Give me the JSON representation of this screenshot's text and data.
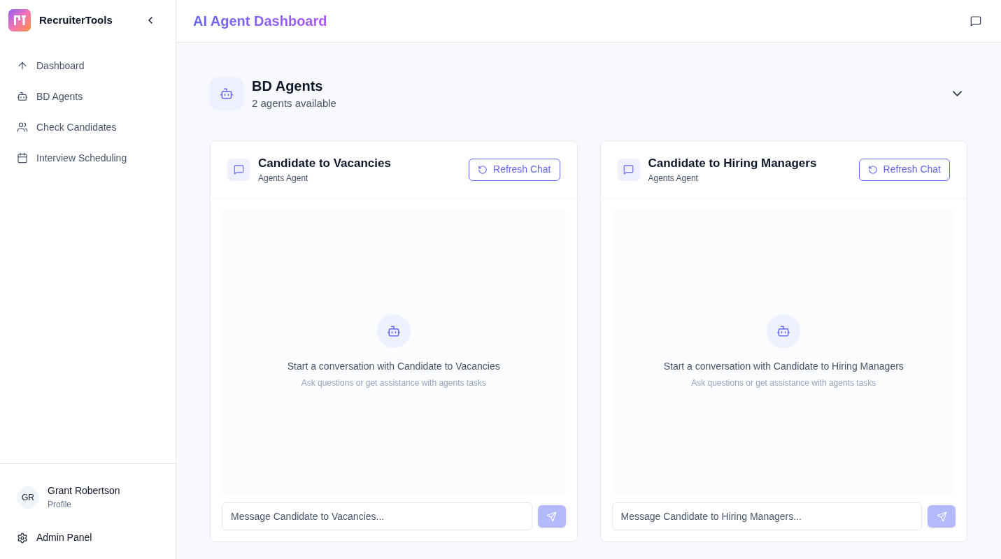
{
  "sidebar": {
    "brand": "RecruiterTools",
    "items": [
      {
        "label": "Dashboard"
      },
      {
        "label": "BD Agents"
      },
      {
        "label": "Check Candidates"
      },
      {
        "label": "Interview Scheduling"
      }
    ],
    "user": {
      "initials": "GR",
      "name": "Grant Robertson",
      "subtitle": "Profile"
    },
    "admin": "Admin Panel"
  },
  "header": {
    "title": "AI Agent Dashboard"
  },
  "section": {
    "title": "BD Agents",
    "subtitle": "2 agents available",
    "expanded": true
  },
  "agents": [
    {
      "name": "Candidate to Vacancies",
      "type": "Agents Agent",
      "refresh": "Refresh Chat",
      "empty_title": "Start a conversation with Candidate to Vacancies",
      "empty_hint": "Ask questions or get assistance with agents tasks",
      "placeholder": "Message Candidate to Vacancies...",
      "send_disabled": true
    },
    {
      "name": "Candidate to Hiring Managers",
      "type": "Agents Agent",
      "refresh": "Refresh Chat",
      "empty_title": "Start a conversation with Candidate to Hiring Managers",
      "empty_hint": "Ask questions or get assistance with agents tasks",
      "placeholder": "Message Candidate to Hiring Managers...",
      "send_disabled": true
    }
  ]
}
